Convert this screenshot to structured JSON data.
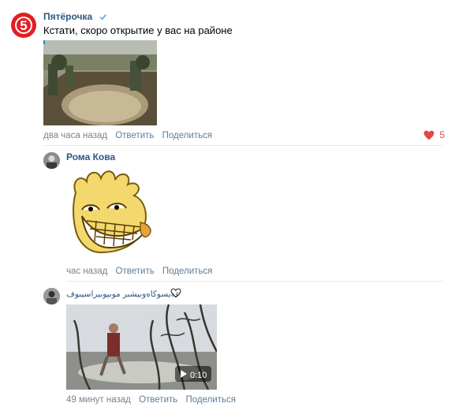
{
  "comments": [
    {
      "author": "Пятёрочка",
      "text": "Кстати, скоро открытие у вас на районе",
      "time": "два часа назад",
      "reply": "Ответить",
      "share": "Поделиться",
      "likes": "5",
      "logo_text": "5"
    },
    {
      "author": "Рома Кова",
      "time": "час назад",
      "reply": "Ответить",
      "share": "Поделиться"
    },
    {
      "author": "عەیسوکاەوىيشىر موىيوىيراسيىوف",
      "time": "49 минут назад",
      "reply": "Ответить",
      "share": "Поделиться",
      "video_duration": "0:10"
    }
  ],
  "colors": {
    "accent": "#2a5885",
    "like": "#e64646",
    "brand_red": "#e31e24"
  }
}
